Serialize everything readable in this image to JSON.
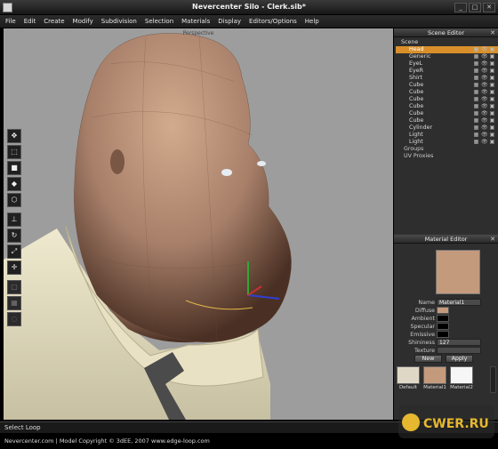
{
  "window": {
    "title": "Nevercenter Silo - Clerk.sib*",
    "buttons": [
      "_",
      "□",
      "✕"
    ]
  },
  "menu": [
    "File",
    "Edit",
    "Create",
    "Modify",
    "Subdivision",
    "Selection",
    "Materials",
    "Display",
    "Editors/Options",
    "Help"
  ],
  "viewport": {
    "label": "Perspective",
    "background": "#9d9d9d"
  },
  "tools": [
    "select-icon",
    "tool-2",
    "cube-icon",
    "tool-4",
    "hexagon-icon",
    "axis-icon",
    "rotate-icon",
    "scale-icon",
    "move-icon",
    "edge-icon",
    "face-icon",
    "loop-icon"
  ],
  "scene_editor": {
    "title": "Scene Editor",
    "root": "Scene",
    "objects": [
      "Head",
      "Generic",
      "EyeL",
      "EyeR",
      "Shirt",
      "Cube",
      "Cube",
      "Cube",
      "Cube",
      "Cube",
      "Cube",
      "Cylinder",
      "Light",
      "Light"
    ],
    "selected_index": 0,
    "extra": [
      "Groups",
      "UV Proxies"
    ]
  },
  "material_editor": {
    "title": "Material Editor",
    "name_label": "Name",
    "name_value": "Material1",
    "diffuse_label": "Diffuse",
    "ambient_label": "Ambient",
    "specular_label": "Specular",
    "emissive_label": "Emissive",
    "shininess_label": "Shininess",
    "shininess_value": "127",
    "texture_label": "Texture",
    "new_label": "New",
    "apply_label": "Apply",
    "materials": [
      {
        "name": "Default",
        "color": "#e0d8c6"
      },
      {
        "name": "Material1",
        "color": "#c49a7d"
      },
      {
        "name": "Material2",
        "color": "#f6f6f6"
      }
    ],
    "colors": {
      "diffuse": "#c49a7d",
      "ambient": "#000000",
      "specular": "#000000",
      "emissive": "#000000"
    }
  },
  "status": "Select Loop",
  "caption": "Nevercenter.com | Model Copyright © 3dEE, 2007    www.edge-loop.com",
  "watermark": "CWER.RU",
  "accent": "#d9902a"
}
